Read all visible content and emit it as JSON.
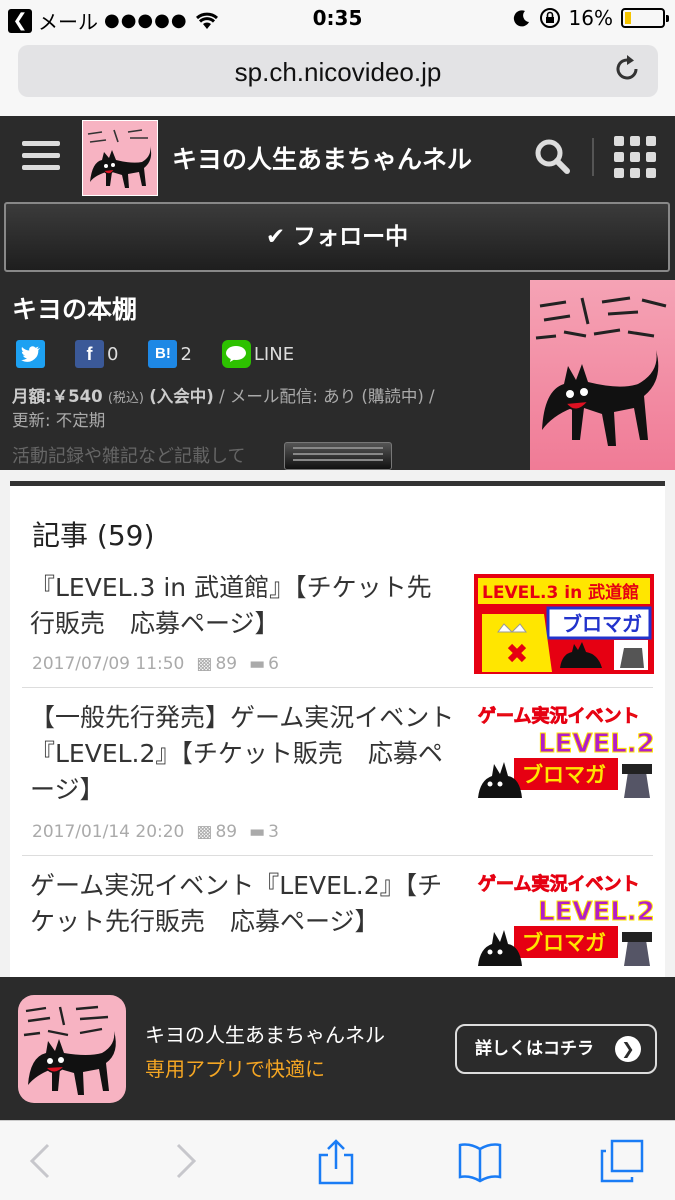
{
  "status_bar": {
    "back_app": "メール",
    "signal": "●●●●●",
    "time": "0:35",
    "battery": "16%",
    "battery_level": 0.16
  },
  "browser": {
    "url": "sp.ch.nicovideo.jp"
  },
  "header": {
    "title": "キヨの人生あまちゃんネル"
  },
  "follow": {
    "label": "フォロー中"
  },
  "channel": {
    "name": "キヨの本棚",
    "share": {
      "facebook_count": "0",
      "hatena_count": "2",
      "line_label": "LINE",
      "hatena_icon": "B!"
    },
    "price_label": "月額:",
    "price_value": "￥540",
    "tax_note": "(税込)",
    "member_status": "(入会中)",
    "mail_info": "/ メール配信: あり (購読中) /",
    "update_info": "更新: 不定期",
    "description": "活動記録や雑記など記載して"
  },
  "articles": {
    "heading": "記事 (59)",
    "items": [
      {
        "title": "『LEVEL.3 in 武道館』【チケット先行販売　応募ページ】",
        "date": "2017/07/09 11:50",
        "comments": "89",
        "tags": "6",
        "thumb_text_1": "LEVEL.3 in 武道館",
        "thumb_text_2": "ブロマガ"
      },
      {
        "title": "【一般先行発売】ゲーム実況イベント『LEVEL.2』【チケット販売　応募ページ】",
        "date": "2017/01/14 20:20",
        "comments": "89",
        "tags": "3",
        "thumb_text_1": "ゲーム実況イベント",
        "thumb_text_2": "LEVEL.2",
        "thumb_text_3": "ブロマガ"
      },
      {
        "title": "ゲーム実況イベント『LEVEL.2』【チケット先行販売　応募ページ】",
        "thumb_text_1": "ゲーム実況イベント",
        "thumb_text_2": "LEVEL.2",
        "thumb_text_3": "ブロマガ"
      }
    ]
  },
  "app_banner": {
    "name": "キヨの人生あまちゃんネル",
    "subtitle": "専用アプリで快適に",
    "button": "詳しくはコチラ"
  },
  "colors": {
    "header_bg": "#2b2b2b",
    "accent_orange": "#f5a623",
    "logo_pink": "#f7b3c2",
    "twitter": "#1da1f2",
    "facebook": "#3b5998",
    "hatena": "#1e88e5",
    "line": "#2dc100",
    "ios_blue": "#1a7cf5"
  },
  "icons": [
    "menu-icon",
    "search-icon",
    "apps-grid-icon",
    "check-icon",
    "comment-icon",
    "folder-icon",
    "back-icon",
    "forward-icon",
    "share-icon",
    "bookmarks-icon",
    "tabs-icon",
    "reload-icon"
  ]
}
